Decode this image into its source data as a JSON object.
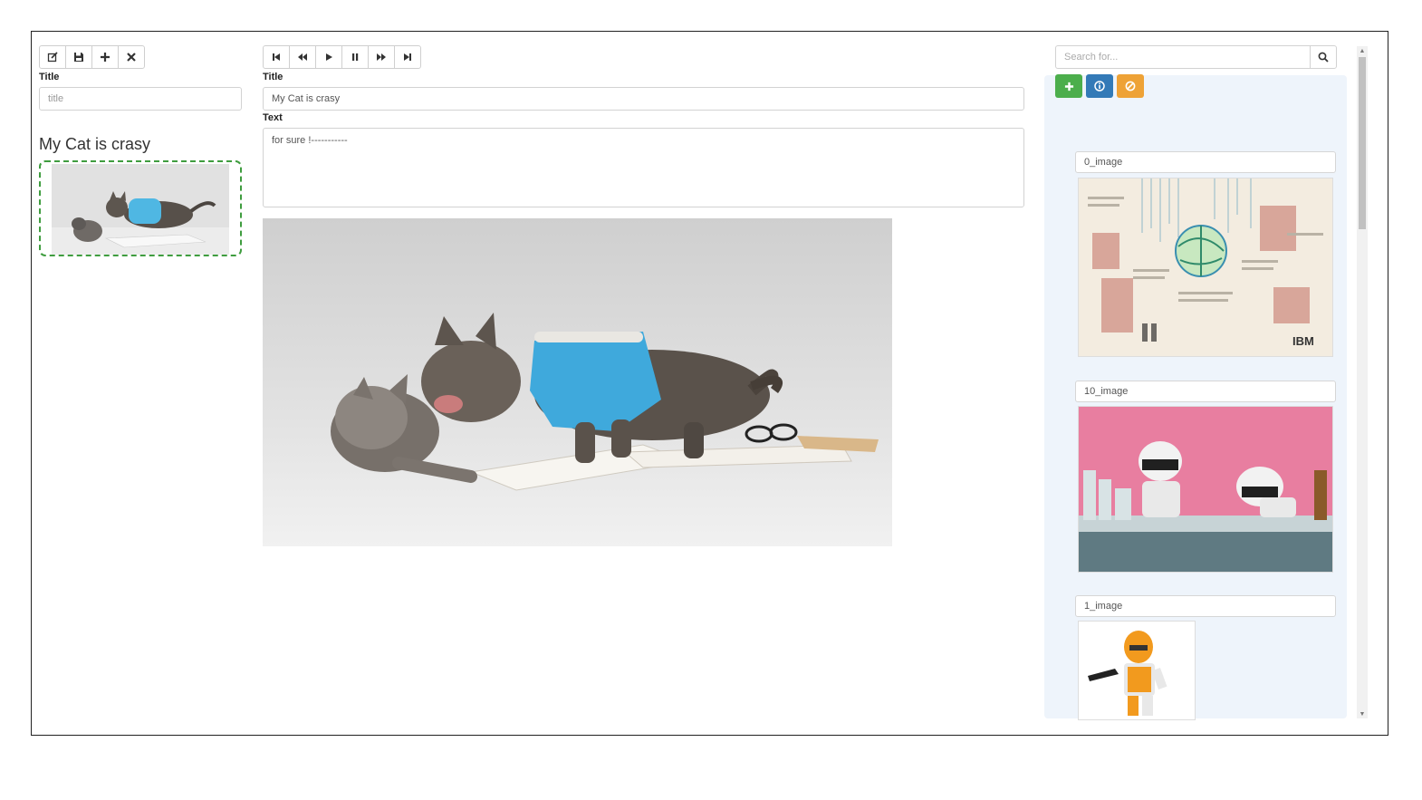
{
  "left_panel": {
    "toolbar": {
      "buttons": [
        {
          "name": "edit-button",
          "icon": "edit-icon"
        },
        {
          "name": "save-button",
          "icon": "save-icon"
        },
        {
          "name": "add-button",
          "icon": "plus-icon"
        },
        {
          "name": "delete-button",
          "icon": "close-icon"
        }
      ]
    },
    "title_label": "Title",
    "title_input_placeholder": "title",
    "document_title": "My Cat is crasy"
  },
  "editor": {
    "toolbar": {
      "buttons": [
        {
          "name": "first-button",
          "icon": "step-backward-icon"
        },
        {
          "name": "rewind-button",
          "icon": "backward-icon"
        },
        {
          "name": "play-button",
          "icon": "play-icon"
        },
        {
          "name": "pause-button",
          "icon": "pause-icon"
        },
        {
          "name": "fast-forward-button",
          "icon": "forward-icon"
        },
        {
          "name": "last-button",
          "icon": "step-forward-icon"
        }
      ]
    },
    "title_label": "Title",
    "title_value": "My Cat is crasy",
    "text_label": "Text",
    "text_value": "for sure !-----------"
  },
  "right_panel": {
    "search_placeholder": "Search for...",
    "actions": [
      {
        "name": "add-image-button",
        "icon": "plus-icon",
        "color": "#4cae4c"
      },
      {
        "name": "info-button",
        "icon": "info-icon",
        "color": "#337ab7"
      },
      {
        "name": "ban-button",
        "icon": "ban-icon",
        "color": "#eea236"
      }
    ],
    "images": [
      {
        "label": "0_image",
        "caption": "IBM"
      },
      {
        "label": "10_image"
      },
      {
        "label": "1_image"
      }
    ]
  }
}
